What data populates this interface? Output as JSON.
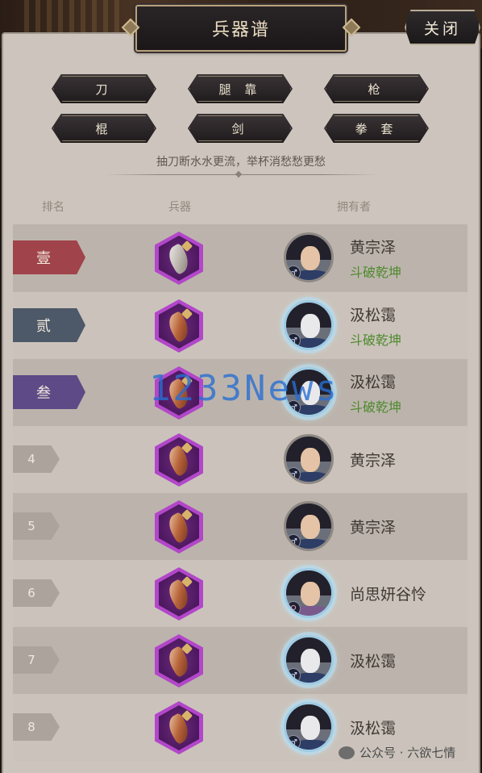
{
  "window": {
    "title": "兵器谱",
    "close_label": "关闭"
  },
  "filters": [
    "刀",
    "腿 靠",
    "枪",
    "棍",
    "剑",
    "拳 套"
  ],
  "subtitle": "抽刀断水水更流，举杯消愁愁更愁",
  "columns": {
    "rank": "排名",
    "weapon": "兵器",
    "owner": "拥有者"
  },
  "rows": [
    {
      "rank": "壹",
      "owner": "黄宗泽",
      "sect": "斗破乾坤",
      "gender": "♂"
    },
    {
      "rank": "贰",
      "owner": "汲松霭",
      "sect": "斗破乾坤",
      "gender": "♂"
    },
    {
      "rank": "叁",
      "owner": "汲松霭",
      "sect": "斗破乾坤",
      "gender": "♂"
    },
    {
      "rank": "4",
      "owner": "黄宗泽",
      "sect": "",
      "gender": "♂"
    },
    {
      "rank": "5",
      "owner": "黄宗泽",
      "sect": "",
      "gender": "♂"
    },
    {
      "rank": "6",
      "owner": "尚思妍谷怜",
      "sect": "",
      "gender": "♀"
    },
    {
      "rank": "7",
      "owner": "汲松霭",
      "sect": "",
      "gender": "♂"
    },
    {
      "rank": "8",
      "owner": "汲松霭",
      "sect": "",
      "gender": "♂"
    }
  ],
  "colors": {
    "rank1": "#a0434a",
    "rank2": "#4d5868",
    "rank3": "#5e4a86",
    "sect": "#4f8a2e",
    "weapon_frame": "#b247c9"
  },
  "watermark": "1233News",
  "footer": "公众号 · 六欲七情"
}
